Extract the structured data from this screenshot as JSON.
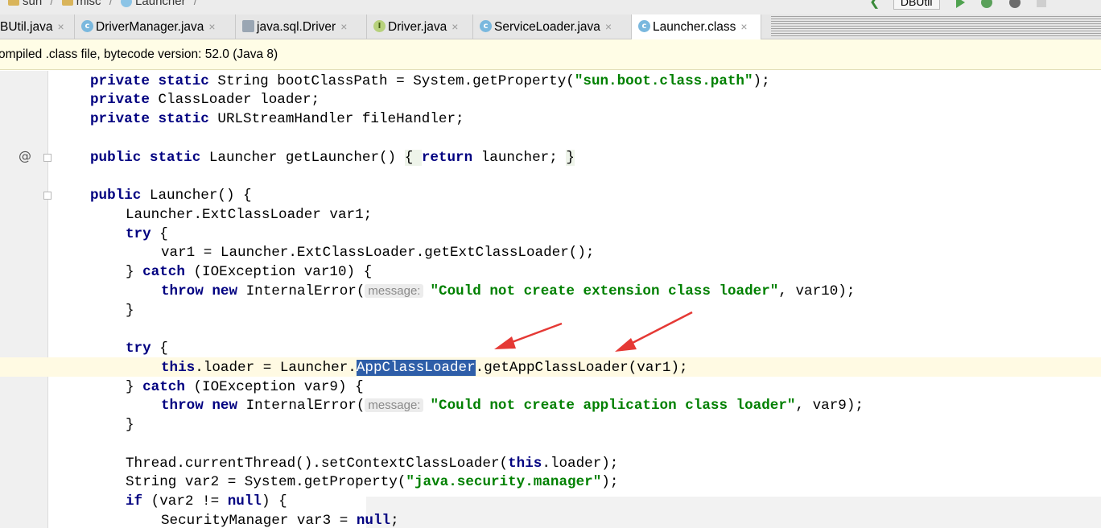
{
  "breadcrumb": [
    "sun",
    "misc",
    "Launcher"
  ],
  "run_config": "DBUtil",
  "tabs": [
    {
      "label": "BUtil.java",
      "icon": "none"
    },
    {
      "label": "DriverManager.java",
      "icon": "c"
    },
    {
      "label": "java.sql.Driver",
      "icon": "j"
    },
    {
      "label": "Driver.java",
      "icon": "i"
    },
    {
      "label": "ServiceLoader.java",
      "icon": "s"
    },
    {
      "label": "Launcher.class",
      "icon": "c",
      "active": true
    }
  ],
  "tab_close_glyph": "×",
  "notice": "ompiled .class file, bytecode version: 52.0 (Java 8)",
  "hints": {
    "message": "message:"
  },
  "code": {
    "l1_kw1": "private",
    "l1_kw2": "static",
    "l1_a": " String bootClassPath = System.getProperty(",
    "l1_str": "\"sun.boot.class.path\"",
    "l1_b": ");",
    "l2_kw1": "private",
    "l2_a": " ClassLoader loader;",
    "l3_kw1": "private",
    "l3_kw2": "static",
    "l3_a": " URLStreamHandler fileHandler;",
    "l5_kw1": "public",
    "l5_kw2": "static",
    "l5_a": " Launcher getLauncher() ",
    "l5_b1": "{ ",
    "l5_kw3": "return",
    "l5_c": " launcher; ",
    "l5_b2": "}",
    "l7_kw1": "public",
    "l7_a": " Launcher() {",
    "l8_a": "Launcher.ExtClassLoader var1;",
    "l9_kw1": "try",
    "l9_a": " {",
    "l10_a": "var1 = Launcher.ExtClassLoader.getExtClassLoader();",
    "l11_a": "} ",
    "l11_kw1": "catch",
    "l11_b": " (IOException var10) {",
    "l12_kw1": "throw",
    "l12_kw2": "new",
    "l12_a": " InternalError(",
    "l12_str": "\"Could not create extension class loader\"",
    "l12_b": ", var10);",
    "l13_a": "}",
    "l15_kw1": "try",
    "l15_a": " {",
    "l16_kw1": "this",
    "l16_a": ".loader = Launcher.",
    "l16_sel": "AppClassLoader",
    "l16_b": ".getAppClassLoader(var1);",
    "l17_a": "} ",
    "l17_kw1": "catch",
    "l17_b": " (IOException var9) {",
    "l18_kw1": "throw",
    "l18_kw2": "new",
    "l18_a": " InternalError(",
    "l18_str": "\"Could not create application class loader\"",
    "l18_b": ", var9);",
    "l19_a": "}",
    "l21_a": "Thread.currentThread().setContextClassLoader(",
    "l21_kw1": "this",
    "l21_b": ".loader);",
    "l22_a": "String var2 = System.getProperty(",
    "l22_str": "\"java.security.manager\"",
    "l22_b": ");",
    "l23_kw1": "if",
    "l23_a": " (var2 != ",
    "l23_kw2": "null",
    "l23_b": ") {",
    "l24_a": "SecurityManager var3 = ",
    "l24_kw1": "null",
    "l24_b": ";"
  },
  "colors": {
    "keyword": "#000080",
    "string": "#008000",
    "selection": "#2e5ea8",
    "annotation_arrow": "#e53935"
  }
}
